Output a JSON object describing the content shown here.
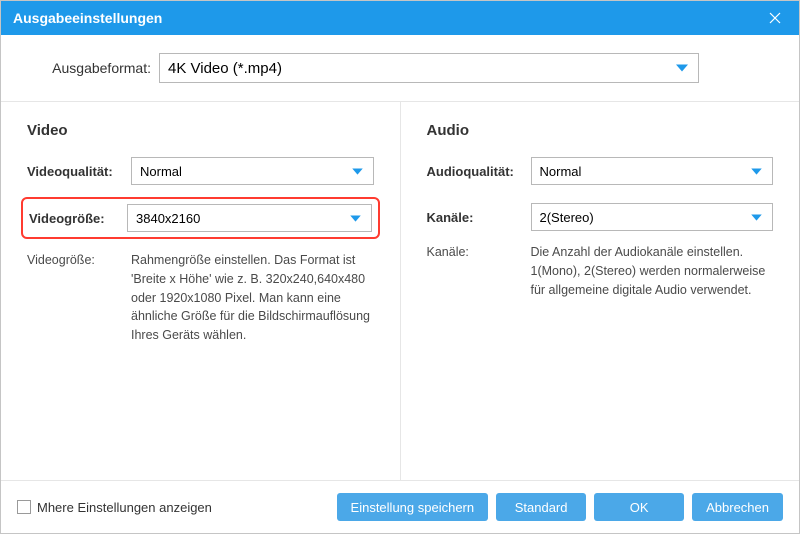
{
  "title": "Ausgabeeinstellungen",
  "format": {
    "label": "Ausgabeformat:",
    "value": "4K Video (*.mp4)"
  },
  "video": {
    "heading": "Video",
    "quality": {
      "label": "Videoqualität:",
      "value": "Normal"
    },
    "size": {
      "label": "Videogröße:",
      "value": "3840x2160"
    },
    "desc": {
      "label": "Videogröße:",
      "text": "Rahmengröße einstellen. Das Format ist 'Breite x Höhe' wie z. B. 320x240,640x480 oder 1920x1080 Pixel. Man kann eine ähnliche Größe für die Bildschirmauflösung Ihres Geräts wählen."
    }
  },
  "audio": {
    "heading": "Audio",
    "quality": {
      "label": "Audioqualität:",
      "value": "Normal"
    },
    "channels": {
      "label": "Kanäle:",
      "value": "2(Stereo)"
    },
    "desc": {
      "label": "Kanäle:",
      "text": "Die Anzahl der Audiokanäle einstellen. 1(Mono), 2(Stereo) werden normalerweise für allgemeine digitale Audio verwendet."
    }
  },
  "footer": {
    "more": "Mhere Einstellungen anzeigen",
    "save": "Einstellung speichern",
    "standard": "Standard",
    "ok": "OK",
    "cancel": "Abbrechen"
  }
}
